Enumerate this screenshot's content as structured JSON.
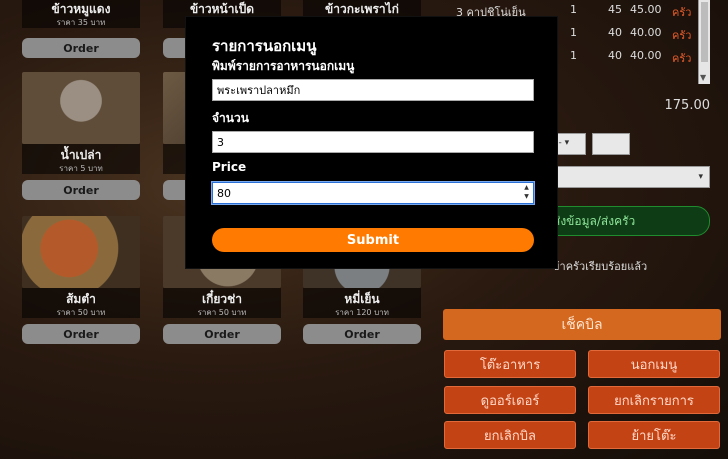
{
  "menu": {
    "order_label": "Order",
    "items": [
      {
        "name": "ข้าวหมูแดง",
        "price": "ราคา 35 บาท"
      },
      {
        "name": "ข้าวหน้าเป็ด",
        "price": ""
      },
      {
        "name": "ข้าวกะเพราไก่",
        "price": ""
      },
      {
        "name": "น้ำเปล่า",
        "price": "ราคา 5 บาท"
      },
      {
        "name": "ส้มตำ",
        "price": "ราคา 50 บาท"
      },
      {
        "name": "เกี๋ยวช่า",
        "price": "ราคา 50 บาท"
      },
      {
        "name": "หมี่เย็น",
        "price": "ราคา 120 บาท"
      }
    ]
  },
  "order": {
    "rows": [
      {
        "name": "3 คาปูชิโน่เย็น",
        "qty": "1",
        "price": "45",
        "total": "45.00",
        "status": "ครัว"
      },
      {
        "name": "",
        "qty": "1",
        "price": "40",
        "total": "40.00",
        "status": "ครัว"
      },
      {
        "name": "",
        "qty": "1",
        "price": "40",
        "total": "40.00",
        "status": "ครัว"
      }
    ],
    "grand_total": "175.00",
    "small_select": "---",
    "send_kitchen_label": "ส่งข้อมูล/ส่งครัว",
    "kitchen_ready_label": "ข้าครัวเรียบร้อยแล้ว"
  },
  "actions": {
    "checkbill": "เช็คบิล",
    "table_food": "โต๊ะอาหาร",
    "off_menu": "นอกเมนู",
    "view_order": "ดูออร์เดอร์",
    "cancel_item": "ยกเลิกรายการ",
    "cancel_bill": "ยกเลิกบิล",
    "move_table": "ย้ายโต๊ะ"
  },
  "modal": {
    "title": "รายการนอกเมนู",
    "name_label": "พิมพ์รายการอาหารนอกเมนู",
    "name_value": "พระเพราปลาหมึก",
    "qty_label": "จำนวน",
    "qty_value": "3",
    "price_label": "Price",
    "price_value": "80",
    "submit_label": "Submit"
  },
  "colors": {
    "accent_orange": "#ff7a00",
    "action_red": "#c44315",
    "kitchen_status": "#e25b2b",
    "send_green": "#0e3c14"
  }
}
